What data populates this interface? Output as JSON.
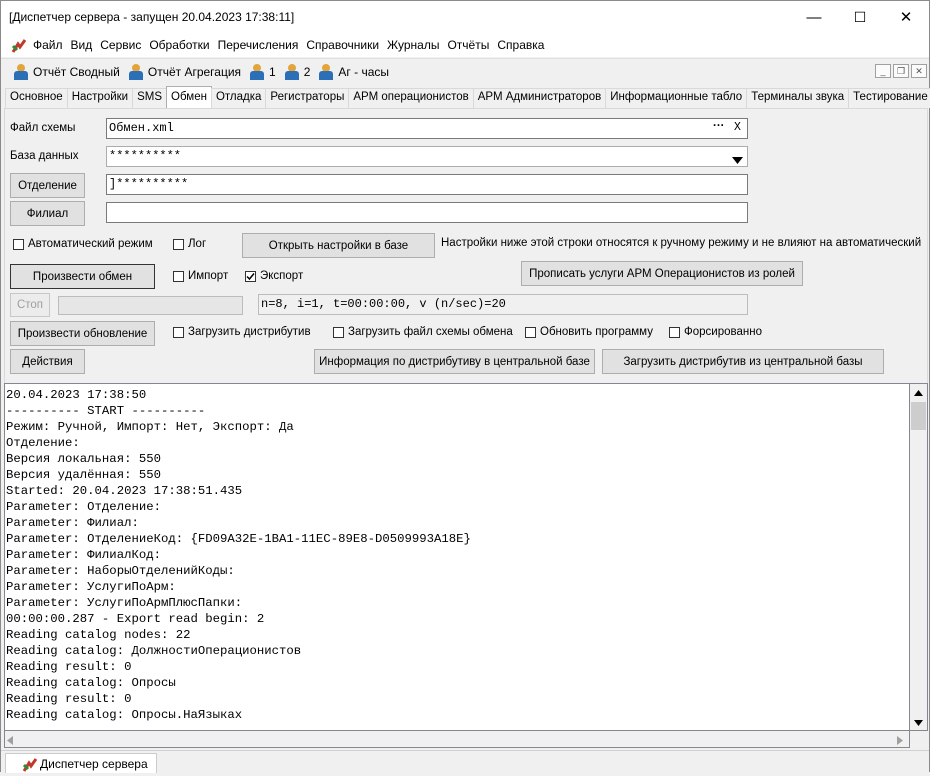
{
  "window": {
    "title": "[Диспетчер сервера - запущен 20.04.2023 17:38:11]",
    "minimize": "—",
    "maximize": "☐",
    "close": "✕"
  },
  "menu": [
    "Файл",
    "Вид",
    "Сервис",
    "Обработки",
    "Перечисления",
    "Справочники",
    "Журналы",
    "Отчёты",
    "Справка"
  ],
  "toolbar": {
    "items": [
      "Отчёт Сводный",
      "Отчёт Агрегация",
      "1",
      "2",
      "Аг - часы"
    ]
  },
  "mdi": {
    "minimize": "_",
    "restore": "❐",
    "close": "✕"
  },
  "tabs": [
    "Основное",
    "Настройки",
    "SMS",
    "Обмен",
    "Отладка",
    "Регистраторы",
    "АРМ операционистов",
    "АРМ Администраторов",
    "Информационные табло",
    "Терминалы звука",
    "Тестирование"
  ],
  "active_tab": "Обмен",
  "form": {
    "schema_file_label": "Файл схемы",
    "schema_file_value": "Обмен.xml",
    "schema_browse": "···",
    "schema_clear": "X",
    "database_label": "База данных",
    "database_value": "**********",
    "department_button": "Отделение",
    "department_value": "]**********",
    "branch_button": "Филиал",
    "branch_value": "",
    "auto_mode_label": "Автоматический режим",
    "log_label": "Лог",
    "open_settings_button": "Открыть настройки в базе",
    "manual_note": "Настройки ниже этой строки относятся к ручному режиму и не влияют на автоматический",
    "exchange_button": "Произвести обмен",
    "import_label": "Импорт",
    "export_label": "Экспорт",
    "prescribe_button": "Прописать услуги АРМ Операционистов из ролей",
    "stop_button": "Стоп",
    "progress_text": "n=8, i=1, t=00:00:00, v (n/sec)=20",
    "update_button": "Произвести обновление",
    "load_distr_label": "Загрузить дистрибутив",
    "load_schema_label": "Загрузить файл схемы обмена",
    "update_program_label": "Обновить программу",
    "force_label": "Форсированно",
    "actions_button": "Действия",
    "distr_info_button": "Информация по дистрибутиву в центральной базе",
    "load_central_button": "Загрузить дистрибутив из центральной базы"
  },
  "checks": {
    "auto_mode": false,
    "log": false,
    "import": false,
    "export": true,
    "load_distr": false,
    "load_schema": false,
    "update_program": false,
    "force": false
  },
  "log_lines": [
    "20.04.2023 17:38:50",
    "---------- START ----------",
    "Режим: Ручной, Импорт: Нет, Экспорт: Да",
    "Отделение:",
    "Версия локальная: 550",
    "Версия удалённая: 550",
    "Started: 20.04.2023 17:38:51.435",
    "Parameter: Отделение:",
    "Parameter: Филиал:",
    "Parameter: ОтделениеКод: {FD09A32E-1BA1-11EC-89E8-D0509993A18E}",
    "Parameter: ФилиалКод:",
    "Parameter: НаборыОтделенийКоды:",
    "Parameter: УслугиПоАрм:",
    "Parameter: УслугиПоАрмПлюсПапки:",
    "00:00:00.287 - Export read begin: 2",
    "Reading catalog nodes: 22",
    "Reading catalog: ДолжностиОперационистов",
    "Reading result: 0",
    "Reading catalog: Опросы",
    "Reading result: 0",
    "Reading catalog: Опросы.НаЯзыках"
  ],
  "taskbar": {
    "item": "Диспетчер сервера"
  },
  "icons": {
    "app": "app-icon",
    "user": "user-icon"
  }
}
